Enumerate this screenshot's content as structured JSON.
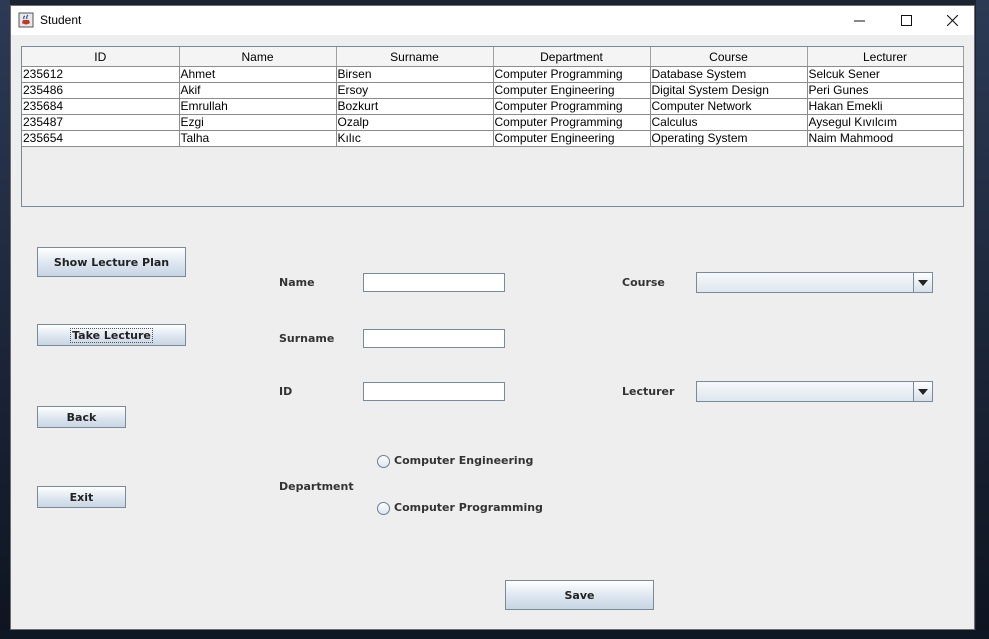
{
  "window": {
    "title": "Student"
  },
  "table": {
    "headers": [
      "ID",
      "Name",
      "Surname",
      "Department",
      "Course",
      "Lecturer"
    ],
    "rows": [
      [
        "235612",
        "Ahmet",
        "Birsen",
        "Computer Programming",
        "Database System",
        "Selcuk Sener"
      ],
      [
        "235486",
        "Akif",
        "Ersoy",
        "Computer Engineering",
        "Digital System Design",
        "Peri Gunes"
      ],
      [
        "235684",
        "Emrullah",
        "Bozkurt",
        "Computer Programming",
        "Computer Network",
        "Hakan Emekli"
      ],
      [
        "235487",
        "Ezgi",
        "Ozalp",
        "Computer Programming",
        "Calculus",
        "Aysegul Kıvılcım"
      ],
      [
        "235654",
        "Talha",
        "Kılıc",
        "Computer Engineering",
        "Operating System",
        "Naim Mahmood"
      ]
    ]
  },
  "buttons": {
    "show_lecture_plan": "Show Lecture Plan",
    "take_lecture": "Take Lecture",
    "back": "Back",
    "exit": "Exit",
    "save": "Save"
  },
  "form": {
    "name_label": "Name",
    "surname_label": "Surname",
    "id_label": "ID",
    "department_label": "Department",
    "course_label": "Course",
    "lecturer_label": "Lecturer",
    "name_value": "",
    "surname_value": "",
    "id_value": "",
    "course_value": "",
    "lecturer_value": "",
    "department_options": [
      "Computer Engineering",
      "Computer Programming"
    ]
  },
  "icons": {
    "app": "java-cup-icon",
    "minimize": "minimize-icon",
    "maximize": "maximize-icon",
    "close": "close-icon",
    "dropdown": "chevron-down-icon"
  }
}
